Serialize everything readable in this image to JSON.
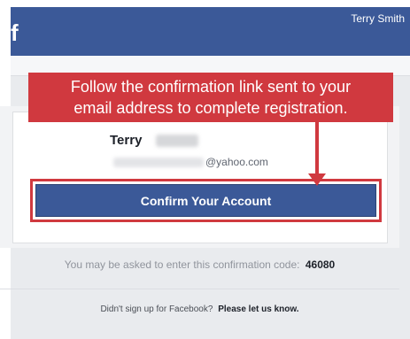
{
  "header": {
    "logo_letter": "f",
    "user_name": "Terry Smith"
  },
  "callout": {
    "line1": "Follow the confirmation link sent to your",
    "line2": "email address to complete registration."
  },
  "account": {
    "first_name": "Terry",
    "email_domain": "@yahoo.com"
  },
  "confirm_button": {
    "label": "Confirm Your Account"
  },
  "code_line": {
    "text": "You may be asked to enter this confirmation code:",
    "code": "46080"
  },
  "footer": {
    "text": "Didn't sign up for Facebook?",
    "link": "Please let us know."
  },
  "colors": {
    "facebook_blue": "#3b5998",
    "callout_red": "#d0393f",
    "page_bg": "#e9ebee"
  }
}
